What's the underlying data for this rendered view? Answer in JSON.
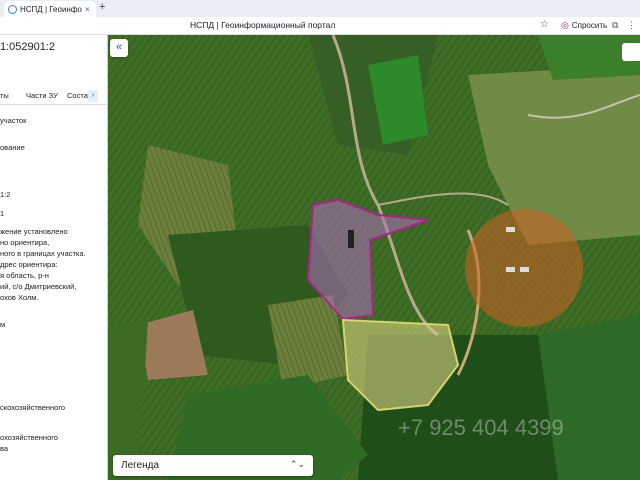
{
  "browser": {
    "tab_title": "НСПД | Геоинформаци",
    "tab_close": "×",
    "new_tab": "+",
    "window_title": "НСПД | Геоинформационный портал",
    "bookmark_icon": "☆",
    "ask_label": "Спросить"
  },
  "sidepanel": {
    "cadastral": "1:052901:2",
    "tabs": [
      "ты",
      "Части ЗУ",
      "Соста"
    ],
    "tab_arrow": "›",
    "text_lines": [
      "участок",
      "ование",
      "1:2",
      "1",
      "жение установлено",
      "но ориентира,",
      "ного в границах участка.",
      "дрес ориентира:",
      "я область, р-н",
      "ий, с/о Дмитриевский,",
      "охов Холм.",
      "м",
      "скохозяйственного",
      "охозяйственного",
      "ва"
    ]
  },
  "map": {
    "collapse_icon": "«",
    "legend_label": "Легенда",
    "legend_chevron": "⌃⌄",
    "watermark": "+7 925 404 4399"
  }
}
